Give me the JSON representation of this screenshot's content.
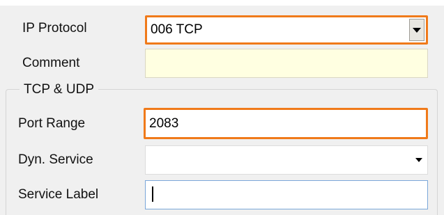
{
  "form": {
    "ip_protocol": {
      "label": "IP Protocol",
      "value": "006 TCP"
    },
    "comment": {
      "label": "Comment",
      "value": ""
    },
    "tcp_udp": {
      "legend": "TCP & UDP",
      "port_range": {
        "label": "Port Range",
        "value": "2083"
      },
      "dyn_service": {
        "label": "Dyn. Service",
        "value": ""
      },
      "service_label": {
        "label": "Service Label",
        "value": ""
      }
    }
  },
  "colors": {
    "highlight": "#f07a1a",
    "comment_bg": "#ffffe1",
    "panel_bg": "#f0f0f0",
    "field_border": "#7f9db9"
  },
  "icons": {
    "protocol_dropdown": "chevron-down-icon",
    "dyn_service_dropdown": "chevron-down-icon"
  }
}
